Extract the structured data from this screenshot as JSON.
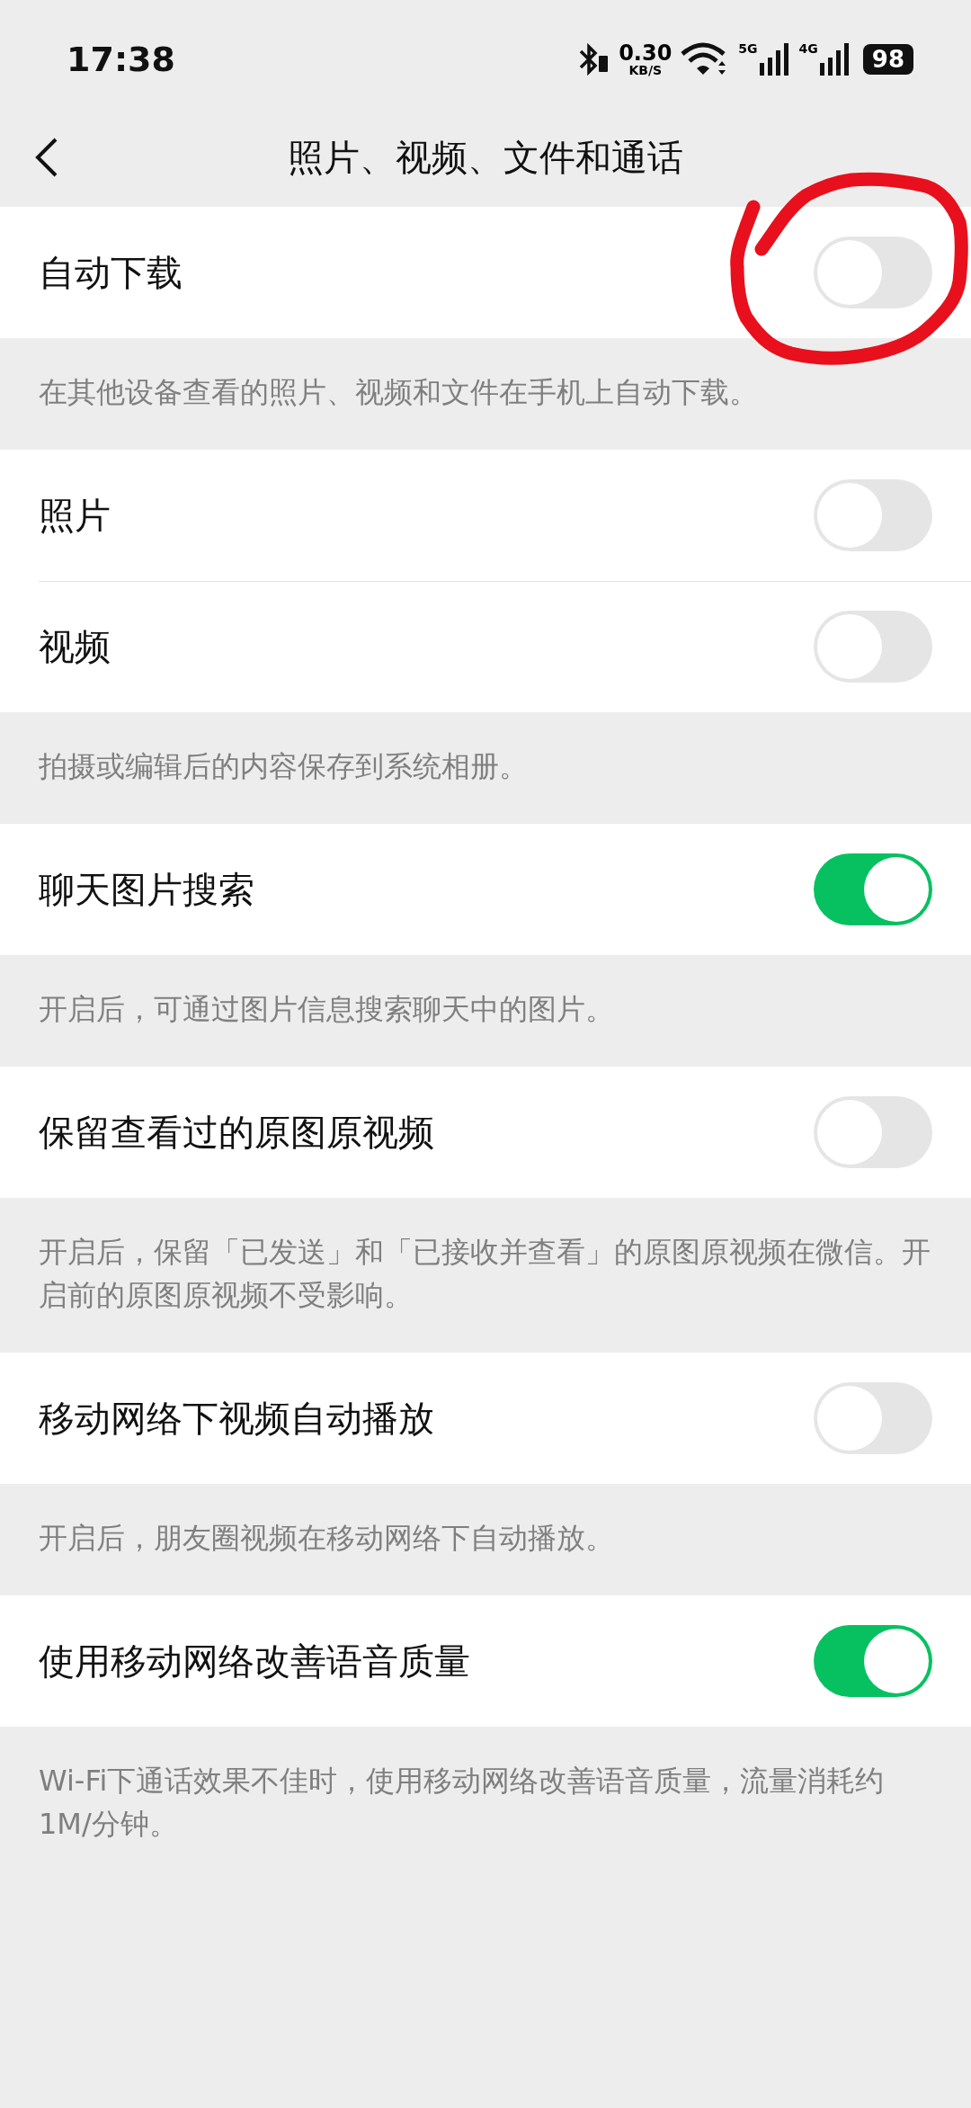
{
  "status_bar": {
    "time": "17:38",
    "speed": "0.30",
    "speed_unit": "KB/S",
    "signals": [
      {
        "label": "5G"
      },
      {
        "label": "4G"
      }
    ],
    "battery": "98"
  },
  "nav": {
    "title": "照片、视频、文件和通话"
  },
  "sections": [
    {
      "items": [
        {
          "label": "自动下载",
          "on": false
        }
      ],
      "note": "在其他设备查看的照片、视频和文件在手机上自动下载。"
    },
    {
      "items": [
        {
          "label": "照片",
          "on": false
        },
        {
          "label": "视频",
          "on": false
        }
      ],
      "note": "拍摄或编辑后的内容保存到系统相册。"
    },
    {
      "items": [
        {
          "label": "聊天图片搜索",
          "on": true
        }
      ],
      "note": "开启后，可通过图片信息搜索聊天中的图片。"
    },
    {
      "items": [
        {
          "label": "保留查看过的原图原视频",
          "on": false
        }
      ],
      "note": "开启后，保留「已发送」和「已接收并查看」的原图原视频在微信。开启前的原图原视频不受影响。"
    },
    {
      "items": [
        {
          "label": "移动网络下视频自动播放",
          "on": false
        }
      ],
      "note": "开启后，朋友圈视频在移动网络下自动播放。"
    },
    {
      "items": [
        {
          "label": "使用移动网络改善语音质量",
          "on": true
        }
      ],
      "note": "Wi-Fi下通话效果不佳时，使用移动网络改善语音质量，流量消耗约1M/分钟。"
    }
  ]
}
